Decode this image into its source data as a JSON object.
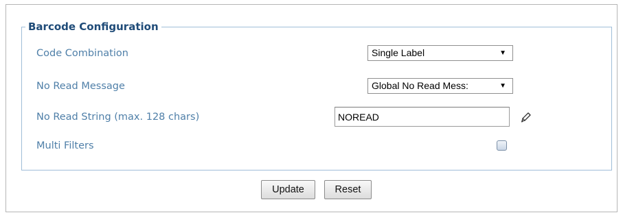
{
  "section": {
    "title": "Barcode Configuration"
  },
  "fields": {
    "code_combination": {
      "label": "Code Combination",
      "value": "Single Label"
    },
    "no_read_message": {
      "label": "No Read Message",
      "value": "Global No Read Mess:"
    },
    "no_read_string": {
      "label": "No Read String (max. 128 chars)",
      "value": "NOREAD"
    },
    "multi_filters": {
      "label": "Multi Filters",
      "checked": false
    }
  },
  "buttons": {
    "update": "Update",
    "reset": "Reset"
  },
  "icons": {
    "dropdown": "chevron-down-icon",
    "edit": "pencil-icon"
  },
  "colors": {
    "legend": "#1f4b78",
    "label": "#4f7fa8",
    "fieldset_border": "#9fbdd8"
  }
}
